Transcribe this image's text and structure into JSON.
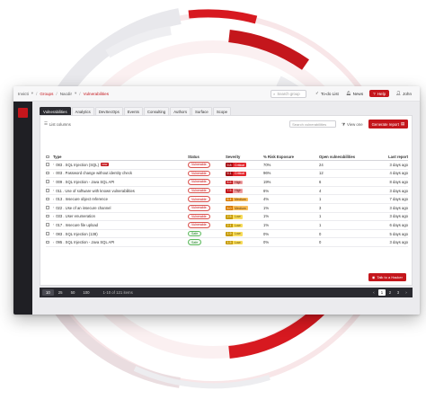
{
  "brand": {
    "accent": "#c4161c",
    "dark": "#1f1f24"
  },
  "breadcrumb": [
    {
      "label": "Invicti",
      "style": "normal"
    },
    {
      "label": "Groups",
      "style": "red"
    },
    {
      "label": "Nacdir",
      "style": "normal"
    },
    {
      "label": "Vulnerabilities",
      "style": "red"
    }
  ],
  "header": {
    "search_placeholder": "Search group",
    "links": [
      {
        "label": "To-do List",
        "icon": "check-icon"
      },
      {
        "label": "News",
        "icon": "bell-icon"
      }
    ],
    "help_label": "Help",
    "user_label": "John"
  },
  "tabs": [
    "Vulnerabilities",
    "Analytics",
    "DevSecOps",
    "Events",
    "Consulting",
    "Authors",
    "Surface",
    "Scope"
  ],
  "toolbar": {
    "list_label": "List columns",
    "filter_placeholder": "Search vulnerabilities",
    "view_label": "View one",
    "generate_label": "Generate report"
  },
  "table": {
    "columns": [
      "Type",
      "Status",
      "Severity",
      "% Risk Exposure",
      "Open vulnerabilities",
      "Last report"
    ],
    "rows": [
      {
        "type": "083 . SQL Injection (SQL)",
        "tag": "new",
        "status": "Vulnerable",
        "sev_num": "9.8",
        "sev_label": "Critical",
        "risk": "70%",
        "open": "24",
        "last": "3 days ago"
      },
      {
        "type": "003 . Password change without identity check",
        "tag": "",
        "status": "Vulnerable",
        "sev_num": "9.1",
        "sev_label": "Critical",
        "risk": "96%",
        "open": "12",
        "last": "4 days ago"
      },
      {
        "type": "009 . SQL Injection - Java SQL API",
        "tag": "",
        "status": "Vulnerable",
        "sev_num": "8.6",
        "sev_label": "High",
        "risk": "19%",
        "open": "6",
        "last": "8 days ago"
      },
      {
        "type": "011 . Use of software with known vulnerabilities",
        "tag": "",
        "status": "Vulnerable",
        "sev_num": "7.5",
        "sev_label": "High",
        "risk": "6%",
        "open": "4",
        "last": "3 days ago"
      },
      {
        "type": "013 . Insecure object reference",
        "tag": "",
        "status": "Vulnerable",
        "sev_num": "6.4",
        "sev_label": "Medium",
        "risk": "4%",
        "open": "1",
        "last": "7 days ago"
      },
      {
        "type": "022 . Use of an insecure channel",
        "tag": "",
        "status": "Vulnerable",
        "sev_num": "5.0",
        "sev_label": "Medium",
        "risk": "1%",
        "open": "3",
        "last": "3 days ago"
      },
      {
        "type": "033 . User enumeration",
        "tag": "",
        "status": "Vulnerable",
        "sev_num": "2.5",
        "sev_label": "Low",
        "risk": "1%",
        "open": "1",
        "last": "3 days ago"
      },
      {
        "type": "017 . Insecure file upload",
        "tag": "",
        "status": "Vulnerable",
        "sev_num": "2.1",
        "sev_label": "Low",
        "risk": "1%",
        "open": "1",
        "last": "6 days ago"
      },
      {
        "type": "083 . SQL Injection (138)",
        "tag": "",
        "status": "Safe",
        "sev_num": "1.9",
        "sev_label": "Low",
        "risk": "0%",
        "open": "0",
        "last": "5 days ago"
      },
      {
        "type": "095 . SQL Injection - Java SQL API",
        "tag": "",
        "status": "Safe",
        "sev_num": "1.5",
        "sev_label": "Low",
        "risk": "0%",
        "open": "0",
        "last": "3 days ago"
      }
    ]
  },
  "action_button": "Talk to a Hacker",
  "pagination": {
    "sizes": [
      "10",
      "25",
      "50",
      "100"
    ],
    "active_size": "10",
    "info": "1-10 of 121 items",
    "pages": [
      "1",
      "2",
      "3"
    ],
    "active_page": "1"
  }
}
